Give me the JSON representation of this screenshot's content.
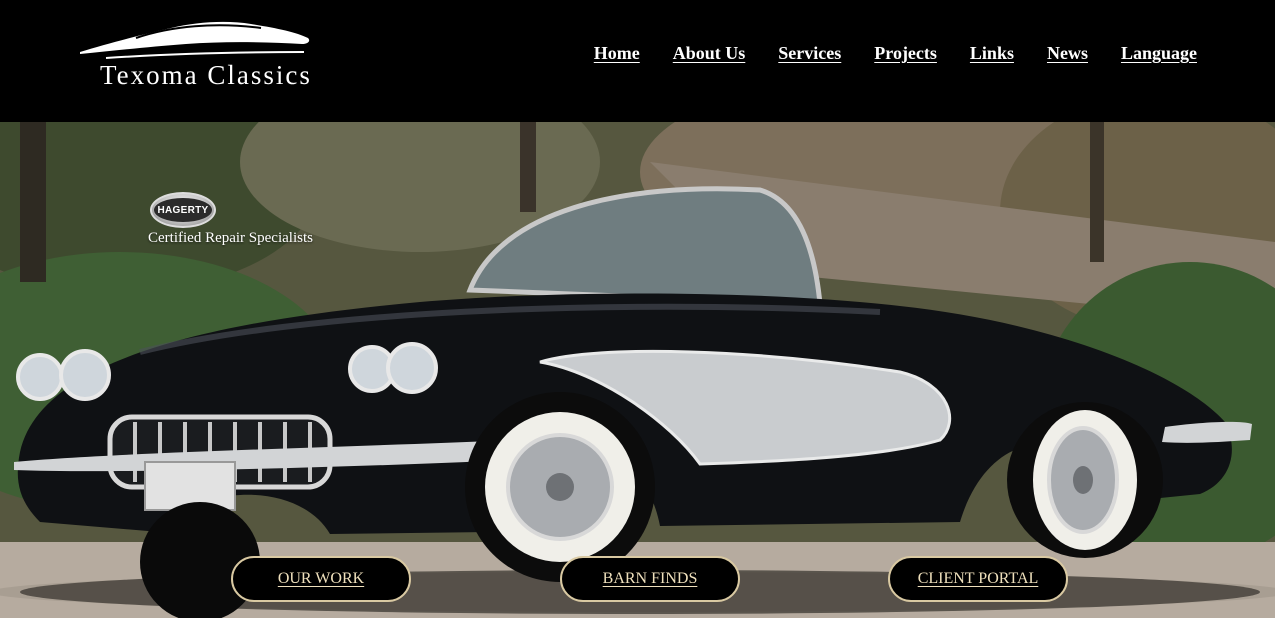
{
  "brand": {
    "name": "Texoma Classics",
    "logo_icon": "car-silhouette-icon"
  },
  "nav": {
    "items": [
      {
        "label": "Home"
      },
      {
        "label": "About Us"
      },
      {
        "label": "Services"
      },
      {
        "label": "Projects"
      },
      {
        "label": "Links"
      },
      {
        "label": "News"
      },
      {
        "label": "Language"
      }
    ]
  },
  "hero": {
    "image": "classic-black-convertible-photo",
    "badge": {
      "logo_text": "HAGERTY",
      "caption": "Certified Repair Specialists"
    },
    "buttons": [
      {
        "label": "OUR WORK"
      },
      {
        "label": "BARN FINDS"
      },
      {
        "label": "CLIENT PORTAL"
      }
    ]
  },
  "colors": {
    "header_bg": "#000000",
    "nav_text": "#ffffff",
    "button_bg": "#000000",
    "button_border": "#d9c9a2",
    "button_text": "#efe0bc"
  }
}
